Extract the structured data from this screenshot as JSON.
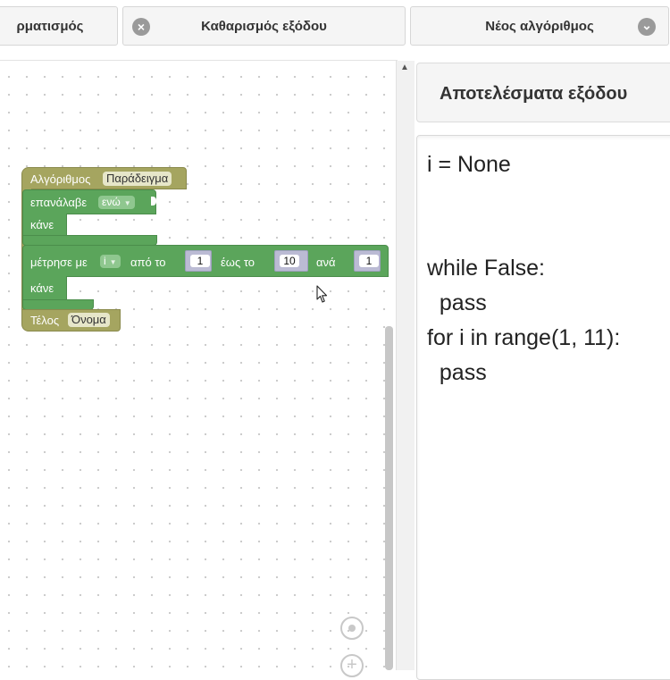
{
  "toolbar": {
    "format_label": "ρματισμός",
    "clear_output_label": "Καθαρισμός εξόδου",
    "new_algorithm_label": "Νέος αλγόριθμος",
    "close_icon": "×",
    "chevron_icon": "⌄"
  },
  "workspace": {
    "scroll_up_arrow": "▲",
    "zoom_in_symbol": "+",
    "blocks": {
      "algorithm_keyword": "Αλγόριθμος",
      "algorithm_name": "Παράδειγμα",
      "repeat_keyword": "επανάλαβε",
      "repeat_mode": "ενώ",
      "do_keyword_1": "κάνε",
      "count_keyword": "μέτρησε με",
      "count_variable": "i",
      "from_keyword": "από το",
      "from_value": "1",
      "to_keyword": "έως το",
      "to_value": "10",
      "by_keyword": "ανά",
      "by_value": "1",
      "do_keyword_2": "κάνε",
      "end_keyword": "Τέλος",
      "end_name": "Όνομα"
    }
  },
  "output": {
    "title": "Αποτελέσματα εξόδου",
    "code_lines": [
      "i = None",
      "",
      "",
      "while False:",
      "  pass",
      "for i in range(1, 11):",
      "  pass"
    ]
  },
  "colors": {
    "algorithm_block": "#a5a560",
    "loop_block": "#5ba55b",
    "number_block": "#bbbbd4"
  }
}
